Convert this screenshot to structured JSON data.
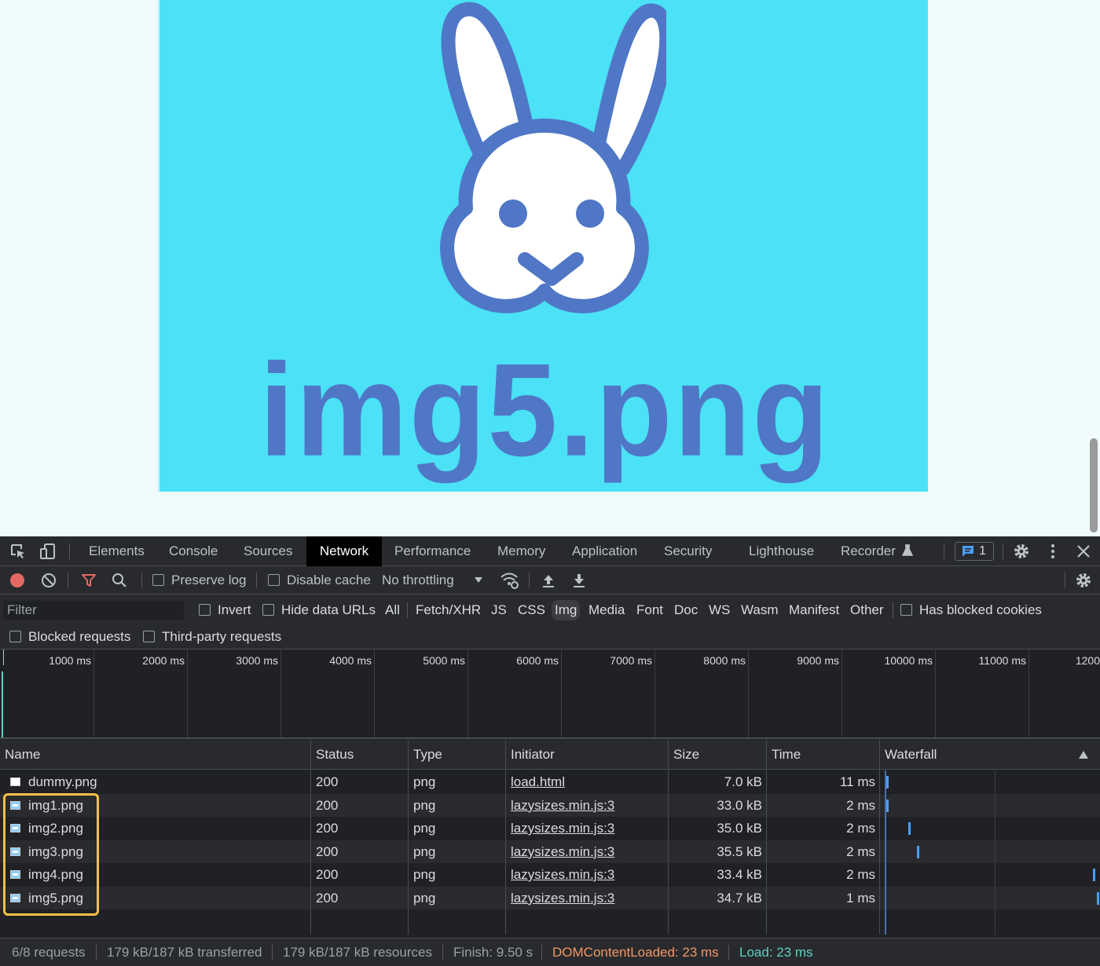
{
  "page": {
    "hero_text": "img5.png"
  },
  "devtools": {
    "tabs": [
      {
        "label": "Elements"
      },
      {
        "label": "Console"
      },
      {
        "label": "Sources"
      },
      {
        "label": "Network",
        "active": true
      },
      {
        "label": "Performance"
      },
      {
        "label": "Memory"
      },
      {
        "label": "Application"
      },
      {
        "label": "Security"
      },
      {
        "label": "Lighthouse"
      },
      {
        "label": "Recorder"
      }
    ],
    "issues_count": "1",
    "toolbar": {
      "preserve_log": "Preserve log",
      "disable_cache": "Disable cache",
      "throttling": "No throttling"
    },
    "filter": {
      "placeholder": "Filter",
      "invert": "Invert",
      "hide_data_urls": "Hide data URLs",
      "types": [
        "All",
        "Fetch/XHR",
        "JS",
        "CSS",
        "Img",
        "Media",
        "Font",
        "Doc",
        "WS",
        "Wasm",
        "Manifest",
        "Other"
      ],
      "active_type": "Img",
      "has_blocked_cookies": "Has blocked cookies",
      "blocked_requests": "Blocked requests",
      "third_party_requests": "Third-party requests"
    },
    "overview_ticks": [
      "1000 ms",
      "2000 ms",
      "3000 ms",
      "4000 ms",
      "5000 ms",
      "6000 ms",
      "7000 ms",
      "8000 ms",
      "9000 ms",
      "10000 ms",
      "11000 ms",
      "1200"
    ],
    "columns": {
      "name": "Name",
      "status": "Status",
      "type": "Type",
      "initiator": "Initiator",
      "size": "Size",
      "time": "Time",
      "waterfall": "Waterfall"
    },
    "rows": [
      {
        "name": "dummy.png",
        "status": "200",
        "type": "png",
        "initiator": "load.html",
        "size": "7.0 kB",
        "time": "11 ms",
        "icon": "document-icon"
      },
      {
        "name": "img1.png",
        "status": "200",
        "type": "png",
        "initiator": "lazysizes.min.js:3",
        "size": "33.0 kB",
        "time": "2 ms",
        "icon": "image-icon"
      },
      {
        "name": "img2.png",
        "status": "200",
        "type": "png",
        "initiator": "lazysizes.min.js:3",
        "size": "35.0 kB",
        "time": "2 ms",
        "icon": "image-icon"
      },
      {
        "name": "img3.png",
        "status": "200",
        "type": "png",
        "initiator": "lazysizes.min.js:3",
        "size": "35.5 kB",
        "time": "2 ms",
        "icon": "image-icon"
      },
      {
        "name": "img4.png",
        "status": "200",
        "type": "png",
        "initiator": "lazysizes.min.js:3",
        "size": "33.4 kB",
        "time": "2 ms",
        "icon": "image-icon"
      },
      {
        "name": "img5.png",
        "status": "200",
        "type": "png",
        "initiator": "lazysizes.min.js:3",
        "size": "34.7 kB",
        "time": "1 ms",
        "icon": "image-icon"
      }
    ],
    "status": {
      "requests": "6/8 requests",
      "transferred": "179 kB/187 kB transferred",
      "resources": "179 kB/187 kB resources",
      "finish": "Finish: 9.50 s",
      "dom_content_loaded": "DOMContentLoaded: 23 ms",
      "load": "Load: 23 ms"
    },
    "colors": {
      "dom_content_loaded": "#f29766",
      "load": "#5ed1c4",
      "highlight": "#f5c04a",
      "waterfall_bar": "#4a9ff5"
    }
  }
}
